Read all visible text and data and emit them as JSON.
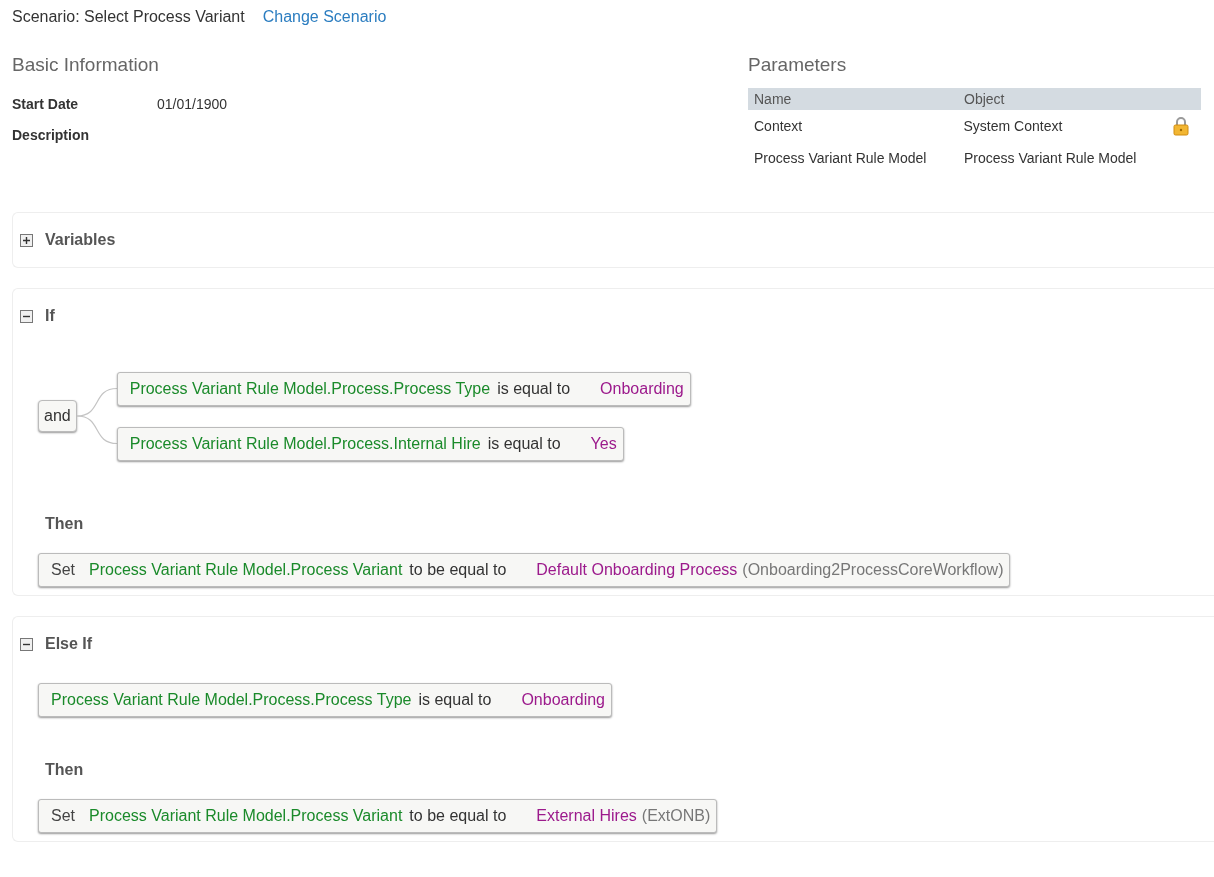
{
  "header": {
    "scenario": "Scenario: Select Process Variant",
    "change_link": "Change Scenario"
  },
  "basic_information": {
    "title": "Basic Information",
    "fields": [
      {
        "label": "Start Date",
        "value": "01/01/1900"
      },
      {
        "label": "Description"
      }
    ]
  },
  "parameters": {
    "title": "Parameters",
    "columns": [
      "Name",
      "Object"
    ],
    "rows": [
      {
        "name": "Context",
        "object": "System Context",
        "locked": true
      },
      {
        "name": "Process Variant Rule Model",
        "object": "Process Variant Rule Model",
        "locked": false
      }
    ]
  },
  "sections": [
    {
      "kind": "variables",
      "title": "Variables",
      "expanded": false
    },
    {
      "kind": "rule",
      "title": "If",
      "expanded": true,
      "joiner": "and",
      "conditions": [
        {
          "field": "Process Variant Rule Model.Process.Process Type",
          "operator": "is equal to",
          "value": "Onboarding"
        },
        {
          "field": "Process Variant Rule Model.Process.Internal Hire",
          "operator": "is equal to",
          "value": "Yes"
        }
      ],
      "then_label": "Then",
      "actions": [
        {
          "verb": "Set",
          "field": "Process Variant Rule Model.Process Variant",
          "operator": "to be equal to",
          "value": "Default Onboarding Process",
          "code": "(Onboarding2ProcessCoreWorkflow)"
        }
      ]
    },
    {
      "kind": "rule",
      "title": "Else If",
      "expanded": true,
      "conditions": [
        {
          "field": "Process Variant Rule Model.Process.Process Type",
          "operator": "is equal to",
          "value": "Onboarding"
        }
      ],
      "then_label": "Then",
      "actions": [
        {
          "verb": "Set",
          "field": "Process Variant Rule Model.Process Variant",
          "operator": "to be equal to",
          "value": "External Hires",
          "code": "(ExtONB)"
        }
      ]
    }
  ]
}
